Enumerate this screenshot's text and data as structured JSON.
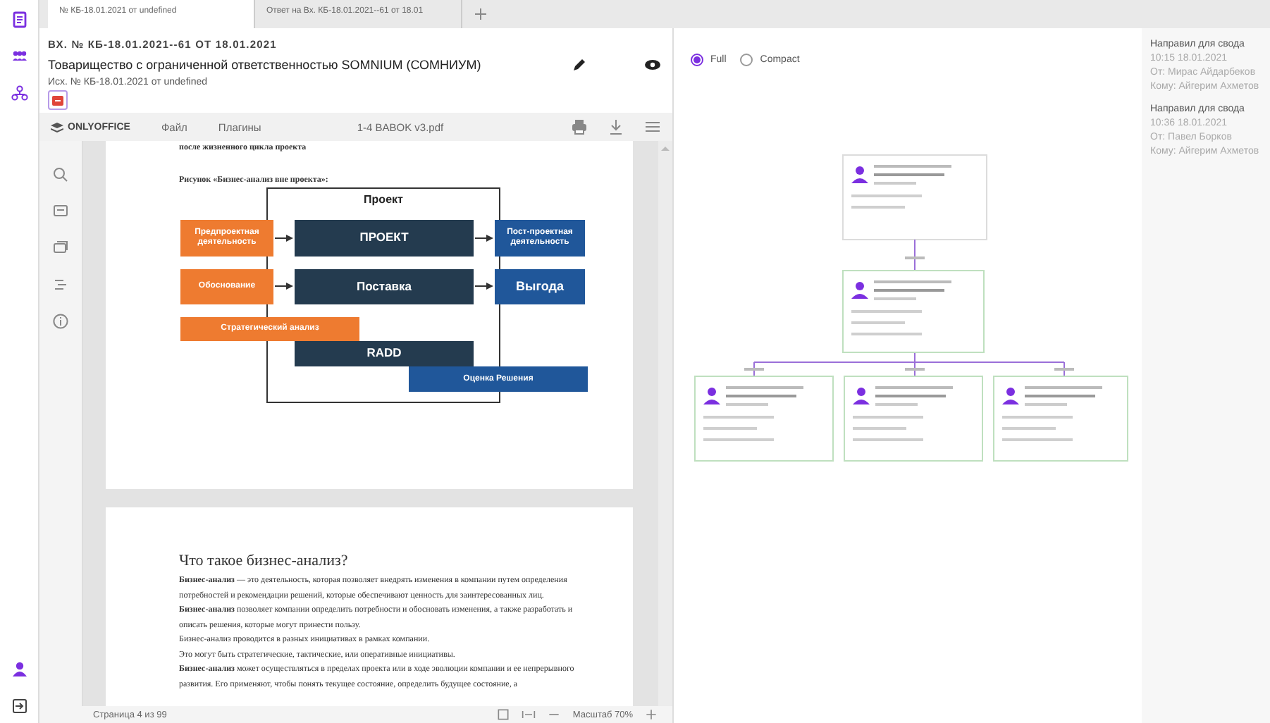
{
  "tabs": [
    {
      "label": "№ КБ-18.01.2021 от undefined",
      "selected": true
    },
    {
      "label": "Ответ на Вх. КБ-18.01.2021--61 от 18.01",
      "selected": false
    }
  ],
  "document": {
    "number": "ВХ. № КБ-18.01.2021--61 ОТ 18.01.2021",
    "title": "Товарищество с ограниченной ответственностью SOMNIUM (СОМНИУМ)",
    "outgoing": "Исх. № КБ-18.01.2021 от undefined"
  },
  "viewer": {
    "brand": "ONLYOFFICE",
    "menu": [
      "Файл",
      "Плагины"
    ],
    "file_name": "1-4 BABOK v3.pdf",
    "page_1": {
      "top_line": "после жизненного цикла проекта",
      "caption": "Рисунок «Бизнес-анализ вне проекта»:",
      "figure": {
        "title": "Проект",
        "boxes": [
          {
            "label": "Предпроектная деятельность",
            "kind": "pre"
          },
          {
            "label": "ПРОЕКТ",
            "kind": "core"
          },
          {
            "label": "Пост-проектная деятельность",
            "kind": "post"
          },
          {
            "label": "Обоснование",
            "kind": "pre"
          },
          {
            "label": "Поставка",
            "kind": "core"
          },
          {
            "label": "Выгода",
            "kind": "post"
          },
          {
            "label": "Стратегический анализ",
            "kind": "pre"
          },
          {
            "label": "RADD",
            "kind": "core"
          },
          {
            "label": "Оценка Решения",
            "kind": "post"
          }
        ]
      }
    },
    "page_2": {
      "heading": "Что такое бизнес-анализ?",
      "paragraphs": [
        "**Бизнес-анализ** — это деятельность, которая позволяет внедрять изменения в компании путем определения потребностей и рекомендации решений, которые обеспечивают ценность для заинтересованных лиц.",
        "**Бизнес-анализ** позволяет компании определить потребности и обосновать изменения, а также разработать и описать решения, которые могут принести пользу.",
        "Бизнес-анализ проводится в разных инициативах в рамках компании.",
        "Это могут быть стратегические, тактические, или оперативные инициативы.",
        "**Бизнес-анализ** может осуществляться в пределах проекта или в ходе эволюции компании и ее непрерывного развития. Его применяют, чтобы понять текущее состояние, определить будущее состояние, а"
      ]
    },
    "status": {
      "page": "Страница 4 из 99",
      "zoom": "Масштаб 70%"
    }
  },
  "view_mode": [
    {
      "label": "Full",
      "selected": true
    },
    {
      "label": "Compact",
      "selected": false
    }
  ],
  "history": [
    {
      "action": "Направил для свода",
      "time": "10:15 18.01.2021",
      "from": "От: Мирас Айдарбеков",
      "to": "Кому: Айгерим Ахметов"
    },
    {
      "action": "Направил для свода",
      "time": "10:36 18.01.2021",
      "from": "От: Павел Борков",
      "to": "Кому: Айгерим Ахметов"
    }
  ]
}
